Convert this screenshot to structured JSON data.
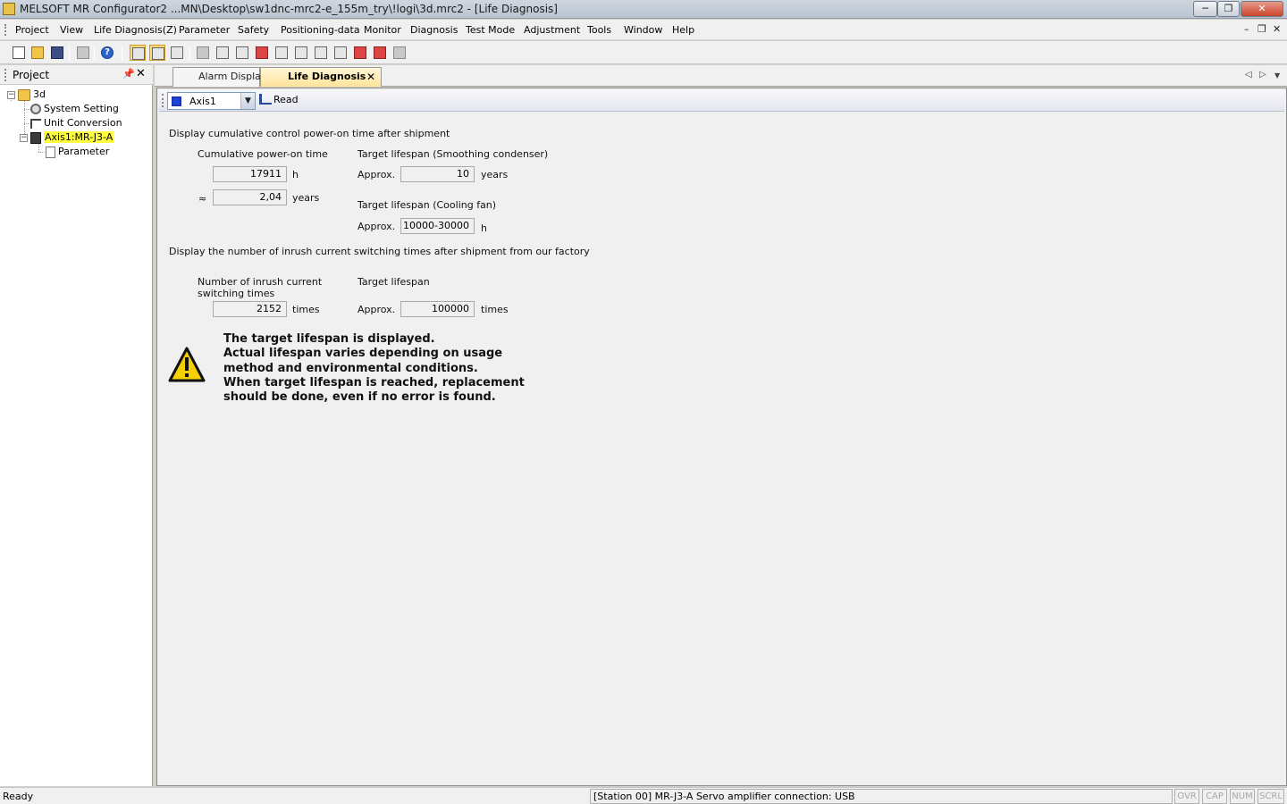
{
  "window": {
    "title": "MELSOFT MR Configurator2 ...MN\\Desktop\\sw1dnc-mrc2-e_155m_try\\!logi\\3d.mrc2 - [Life Diagnosis]",
    "minimize_glyph": "─",
    "restore_glyph": "❐",
    "close_glyph": "✕"
  },
  "menu": {
    "items": [
      "Project",
      "View",
      "Life Diagnosis(Z)",
      "Parameter",
      "Safety",
      "Positioning-data",
      "Monitor",
      "Diagnosis",
      "Test Mode",
      "Adjustment",
      "Tools",
      "Window",
      "Help"
    ],
    "mdi_minimize": "–",
    "mdi_restore": "❐",
    "mdi_close": "✕"
  },
  "toolbar": {
    "icons": [
      "new-file-icon",
      "open-folder-icon",
      "save-icon",
      "print-icon",
      "help-icon",
      "station-icon",
      "find-icon",
      "link-icon",
      "refresh-icon",
      "monitor-icon",
      "io-icon",
      "servo-icon",
      "graph-icon",
      "data-icon",
      "scope-icon",
      "hand-icon",
      "gauge-icon",
      "repair-icon",
      "cloud-icon"
    ],
    "help_glyph": "?"
  },
  "project_panel": {
    "title": "Project",
    "pin_glyph": "📌",
    "close_glyph": "✕",
    "tree": {
      "root": "3d",
      "system_setting": "System Setting",
      "unit_conversion": "Unit Conversion",
      "axis": "Axis1:MR-J3-A",
      "parameter": "Parameter"
    },
    "expand_glyph": "−"
  },
  "tabs": [
    {
      "label": "Alarm Display",
      "active": false
    },
    {
      "label": "Life Diagnosis",
      "active": true
    }
  ],
  "tab_close_glyph": "✕",
  "tab_nav": {
    "prev": "◁",
    "next": "▷",
    "menu": "▼"
  },
  "doc_toolbar": {
    "axis_value": "Axis1",
    "dropdown_glyph": "▼",
    "read_label": "Read"
  },
  "power_on": {
    "heading": "Display cumulative control power-on time after shipment",
    "cumulative_label": "Cumulative power-on time",
    "hours_value": "17911",
    "hours_unit": "h",
    "approx_symbol": "≈",
    "years_value": "2,04",
    "years_unit": "years",
    "smoothing_label": "Target lifespan (Smoothing condenser)",
    "smoothing_prefix": "Approx.",
    "smoothing_value": "10",
    "smoothing_unit": "years",
    "fan_label": "Target lifespan (Cooling fan)",
    "fan_prefix": "Approx.",
    "fan_value": "10000-30000",
    "fan_unit": "h"
  },
  "inrush": {
    "heading": "Display the number of inrush current switching times after shipment from our factory",
    "count_label_1": "Number of inrush current",
    "count_label_2": "switching times",
    "count_value": "2152",
    "count_unit": "times",
    "target_label": "Target lifespan",
    "target_prefix": "Approx.",
    "target_value": "100000",
    "target_unit": "times"
  },
  "warning": {
    "icon": "warning-triangle-icon",
    "lines": [
      "The target lifespan is displayed.",
      "Actual lifespan varies depending on usage",
      "method and environmental conditions.",
      "When target lifespan is reached, replacement",
      "should be done, even if no error is found."
    ]
  },
  "statusbar": {
    "ready": "Ready",
    "connection": "[Station 00] MR-J3-A Servo amplifier connection: USB",
    "indicators": [
      "OVR",
      "CAP",
      "NUM",
      "SCRL"
    ]
  },
  "colors": {
    "active_tab": "#ffe39a",
    "tree_highlight": "#ffff40",
    "warning_yellow": "#f5d000"
  }
}
